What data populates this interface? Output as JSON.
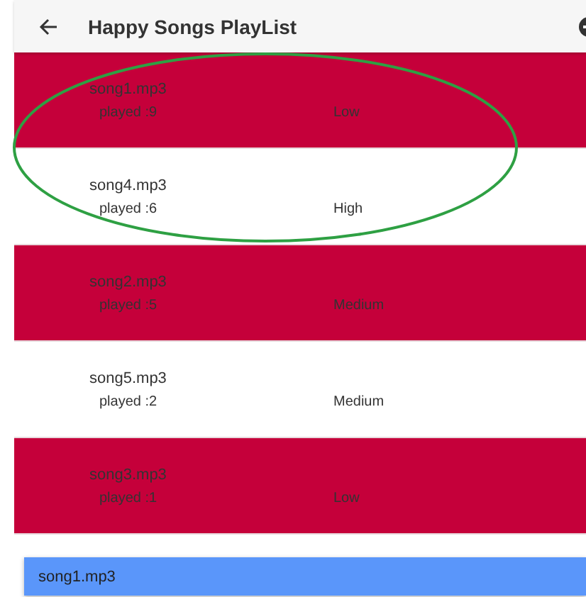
{
  "header": {
    "title": "Happy Songs PlayList"
  },
  "songs": [
    {
      "name": "song1.mp3",
      "played": "played :9",
      "level": "Low",
      "color": "#c5003a"
    },
    {
      "name": "song4.mp3",
      "played": "played :6",
      "level": "High",
      "color": "#ffffff"
    },
    {
      "name": "song2.mp3",
      "played": "played :5",
      "level": "Medium",
      "color": "#c5003a"
    },
    {
      "name": "song5.mp3",
      "played": "played :2",
      "level": "Medium",
      "color": "#ffffff"
    },
    {
      "name": "song3.mp3",
      "played": "played :1",
      "level": "Low",
      "color": "#c5003a"
    }
  ],
  "drag_item": {
    "name": "song1.mp3"
  }
}
